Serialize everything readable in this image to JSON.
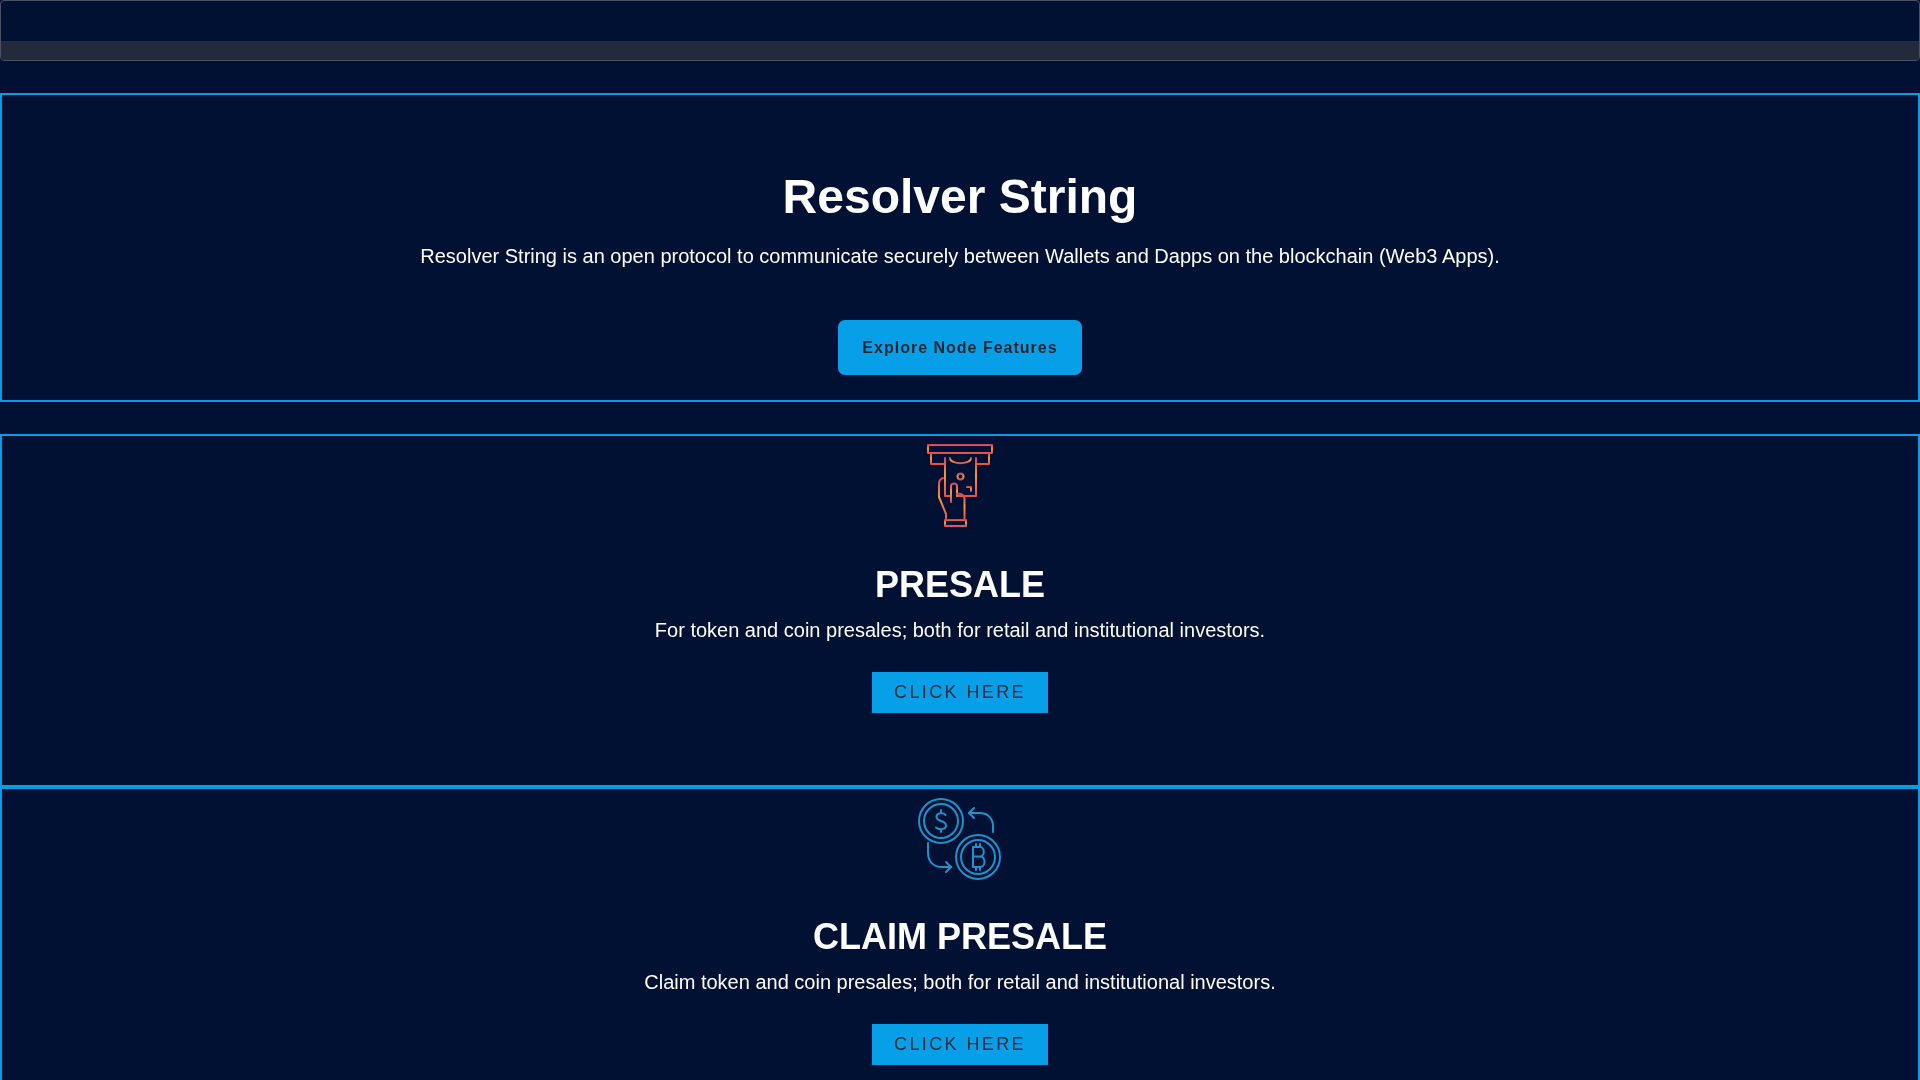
{
  "hero": {
    "title": "Resolver String",
    "description": "Resolver String is an open protocol to communicate securely between Wallets and Dapps on the blockchain (Web3 Apps).",
    "button": "Explore Node Features"
  },
  "features": [
    {
      "kind": "presale",
      "title": "PRESALE",
      "description": "For token and coin presales; both for retail and institutional investors.",
      "button": "CLICK HERE"
    },
    {
      "kind": "claim",
      "title": "CLAIM PRESALE",
      "description": "Claim token and coin presales; both for retail and institutional investors.",
      "button": "CLICK HERE"
    }
  ]
}
